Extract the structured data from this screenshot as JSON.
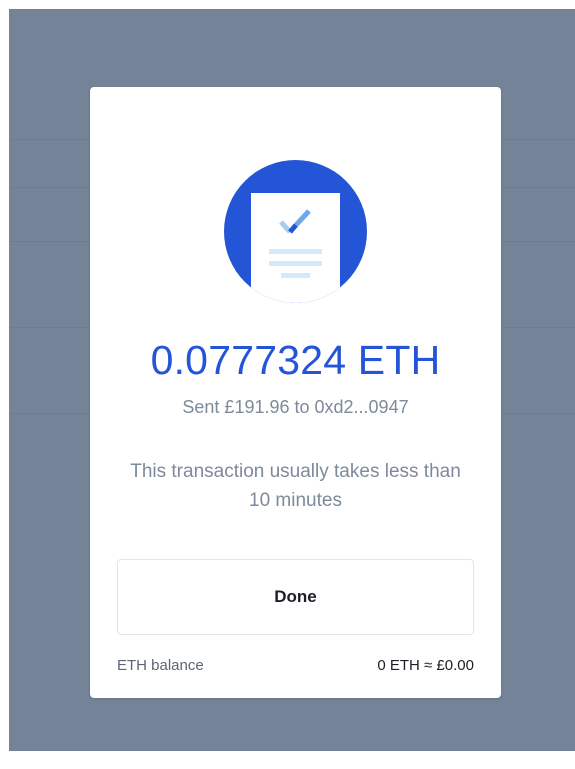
{
  "colors": {
    "accent": "#2455d6",
    "overlay": "#748397",
    "modal": "#ffffff",
    "muted_text": "#7d8a9b"
  },
  "modal": {
    "icon": "sent-document-check-icon",
    "amount": "0.0777324 ETH",
    "sent_line": "Sent £191.96 to 0xd2...0947",
    "note": "This transaction usually takes less than 10 minutes",
    "done_label": "Done",
    "balance": {
      "label": "ETH balance",
      "value": "0 ETH ≈ £0.00"
    }
  }
}
